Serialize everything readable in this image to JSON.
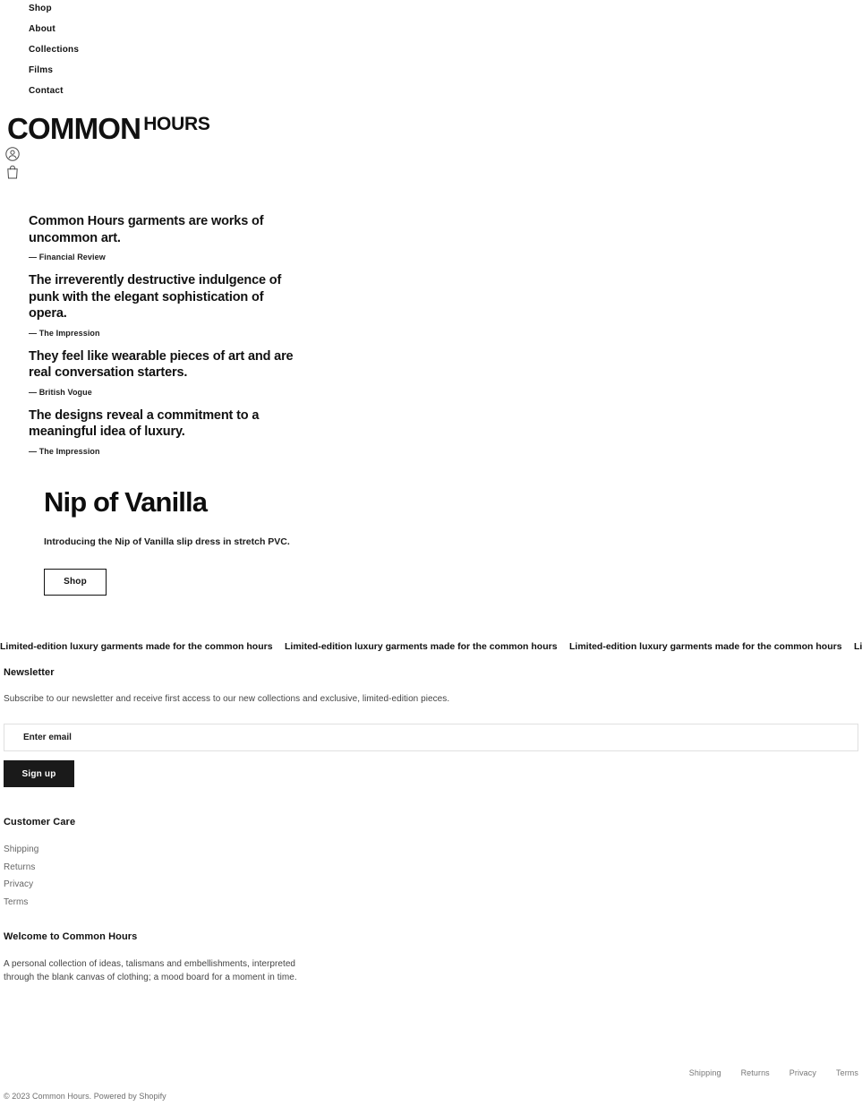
{
  "header": {
    "nav": [
      {
        "label": "Shop"
      },
      {
        "label": "About"
      },
      {
        "label": "Collections"
      },
      {
        "label": "Films"
      },
      {
        "label": "Contact"
      }
    ],
    "logo": {
      "main": "COMMON",
      "sub": "HOURS"
    },
    "icons": [
      {
        "name": "account-icon",
        "title": "Account"
      },
      {
        "name": "shopping-bag-icon",
        "title": "Cart"
      }
    ]
  },
  "quotes": [
    {
      "text": "Common Hours garments are works of uncommon art.",
      "attribution": "— Financial Review"
    },
    {
      "text": "The irreverently destructive indulgence of punk with the elegant sophistication of opera.",
      "attribution": "— The Impression"
    },
    {
      "text": "They feel like wearable pieces of art and are real conversation starters.",
      "attribution": "— British Vogue"
    },
    {
      "text": "The designs reveal a commitment to a meaningful idea of luxury.",
      "attribution": "— The Impression"
    }
  ],
  "hero": {
    "title": "Nip of Vanilla",
    "subtitle": "Introducing the Nip of Vanilla slip dress in stretch PVC.",
    "cta_label": "Shop"
  },
  "marquee": {
    "text": "Limited-edition luxury garments made for the common hours",
    "repeat": 4
  },
  "newsletter": {
    "title": "Newsletter",
    "description": "Subscribe to our newsletter and receive first access to our new collections and exclusive, limited-edition pieces.",
    "input_value": "",
    "input_placeholder": "Enter email",
    "submit_label": "Sign up"
  },
  "customer_care": {
    "title": "Customer Care",
    "links": [
      {
        "label": "Shipping"
      },
      {
        "label": "Returns"
      },
      {
        "label": "Privacy"
      },
      {
        "label": "Terms"
      }
    ]
  },
  "welcome": {
    "title": "Welcome to Common Hours",
    "body": "A personal collection of ideas, talismans and embellishments, interpreted through the blank canvas of clothing; a mood board for a moment in time."
  },
  "footer_bottom": {
    "legal_links": [
      {
        "label": "Shipping"
      },
      {
        "label": "Returns"
      },
      {
        "label": "Privacy"
      },
      {
        "label": "Terms"
      }
    ],
    "copyright_prefix": "© 2023 Common Hours. Powered by ",
    "copyright_link": "Shopify"
  },
  "colors": {
    "text_primary": "#111111",
    "text_muted": "#666666",
    "accent_dark": "#1a1a1a",
    "border_light": "#e0e0e0",
    "background": "#ffffff"
  }
}
